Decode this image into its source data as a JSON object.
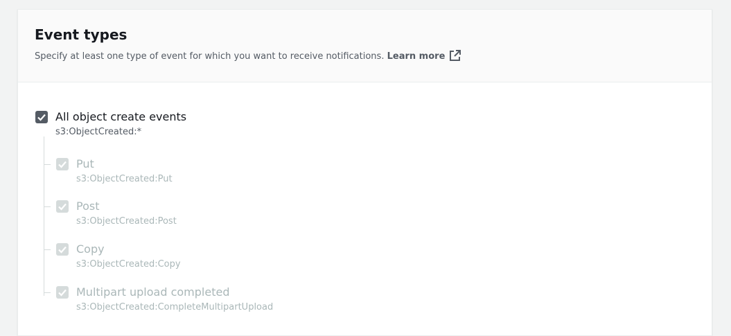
{
  "section": {
    "title": "Event types",
    "description": "Specify at least one type of event for which you want to receive notifications.",
    "learn_more": "Learn more"
  },
  "events": {
    "root": {
      "label": "All object create events",
      "code": "s3:ObjectCreated:*",
      "checked": true
    },
    "children": [
      {
        "label": "Put",
        "code": "s3:ObjectCreated:Put",
        "checked": true,
        "disabled": true
      },
      {
        "label": "Post",
        "code": "s3:ObjectCreated:Post",
        "checked": true,
        "disabled": true
      },
      {
        "label": "Copy",
        "code": "s3:ObjectCreated:Copy",
        "checked": true,
        "disabled": true
      },
      {
        "label": "Multipart upload completed",
        "code": "s3:ObjectCreated:CompleteMultipartUpload",
        "checked": true,
        "disabled": true
      }
    ]
  },
  "colors": {
    "checkbox_checked": "#545b64",
    "checkbox_disabled": "#d5dbdb",
    "disabled_text": "#aab7b8"
  }
}
